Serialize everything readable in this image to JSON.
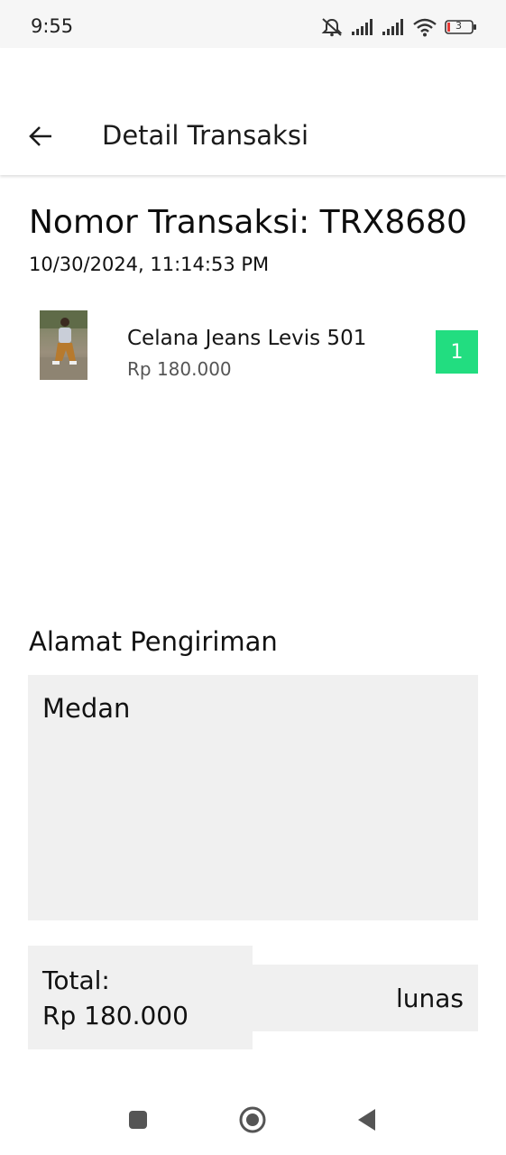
{
  "status_bar": {
    "time": "9:55",
    "battery": "3",
    "icons": [
      "mute-icon",
      "signal-icon",
      "signal-icon",
      "wifi-icon",
      "battery-icon"
    ]
  },
  "app_bar": {
    "title": "Detail Transaksi",
    "back_icon": "arrow-left-icon"
  },
  "transaction": {
    "title": "Nomor Transaksi: TRX8680",
    "datetime": "10/30/2024, 11:14:53 PM"
  },
  "items": [
    {
      "name": "Celana Jeans Levis 501",
      "price": "Rp 180.000",
      "quantity": "1",
      "thumbnail": "product-photo"
    }
  ],
  "shipping": {
    "label": "Alamat Pengiriman",
    "address": "Medan"
  },
  "summary": {
    "total_label": "Total:",
    "total_value": "Rp 180.000",
    "payment_status": "lunas"
  },
  "nav_bar": {
    "icons": [
      "square-icon",
      "circle-home-icon",
      "triangle-back-icon"
    ]
  },
  "colors": {
    "accent_badge": "#22dd80",
    "panel_bg": "#f0f0f0",
    "status_bar_bg": "#f6f6f6"
  }
}
